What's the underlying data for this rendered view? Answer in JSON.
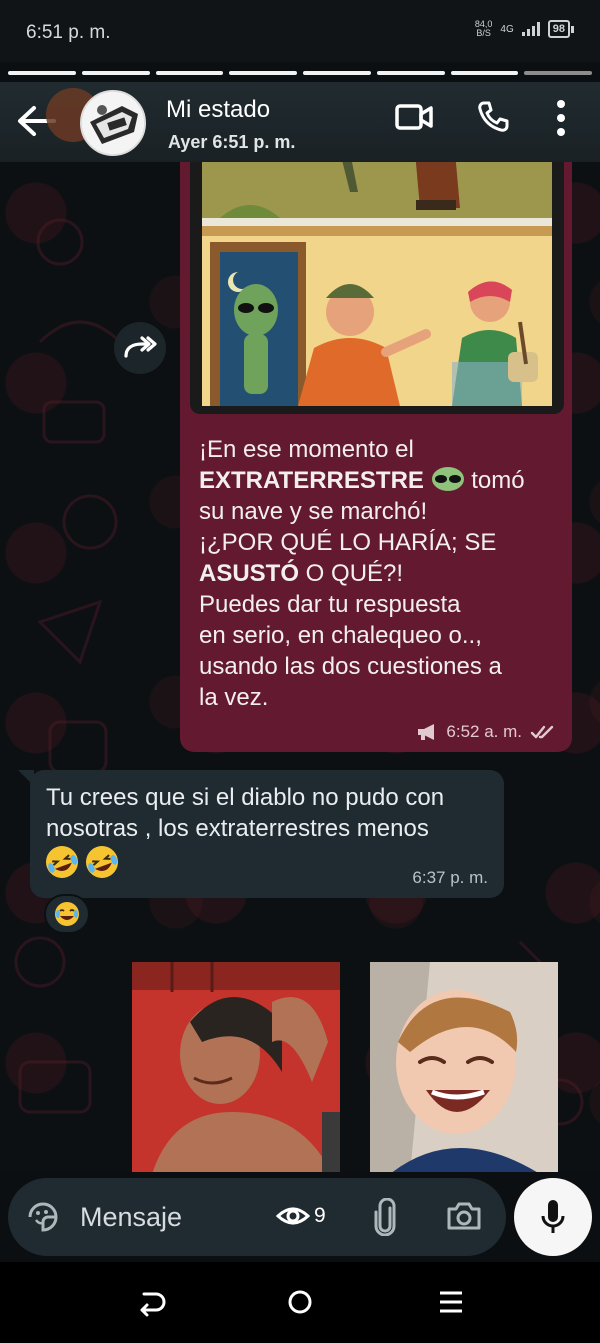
{
  "status_bar": {
    "time": "6:51 p. m.",
    "net_speed_value": "84,0",
    "net_speed_unit": "B/S",
    "network": "4G",
    "battery": "98"
  },
  "story_progress": {
    "segments_viewed": 8,
    "segments_total": 8
  },
  "header": {
    "contact_name": "Mi estado",
    "last_seen": "Ayer 6:51 p. m."
  },
  "messages": {
    "outgoing": {
      "line1": "¡En ese momento el",
      "bold1": "EXTRATERRESTRE",
      "after_emoji": " tomó",
      "line3": "su nave y se marchó!",
      "line4": "¡¿POR QUÉ LO HARÍA; SE",
      "bold2": "ASUSTÓ",
      "after_bold2": " O QUÉ?!",
      "line6": "Puedes dar tu respuesta",
      "line7": "en serio, en chalequeo o..,",
      "line8": "usando las dos cuestiones a",
      "line9": "la vez.",
      "time": "6:52 a. m."
    },
    "incoming": {
      "text": "Tu crees que si el diablo no pudo con nosotras , los extraterrestres menos",
      "time": "6:37 p. m."
    }
  },
  "composer": {
    "placeholder": "Mensaje",
    "view_count": "9"
  },
  "colors": {
    "outgoing_bubble": "#631a30",
    "incoming_bubble": "#1f2b31",
    "header_bg": "#1f292e",
    "chat_bg": "#0c1013"
  },
  "icons": [
    "back-arrow-icon",
    "video-call-icon",
    "phone-icon",
    "more-vert-icon",
    "forward-icon",
    "sticker-icon",
    "eye-icon",
    "attach-icon",
    "camera-icon",
    "mic-icon",
    "nav-back-icon",
    "nav-home-icon",
    "nav-recents-icon"
  ]
}
